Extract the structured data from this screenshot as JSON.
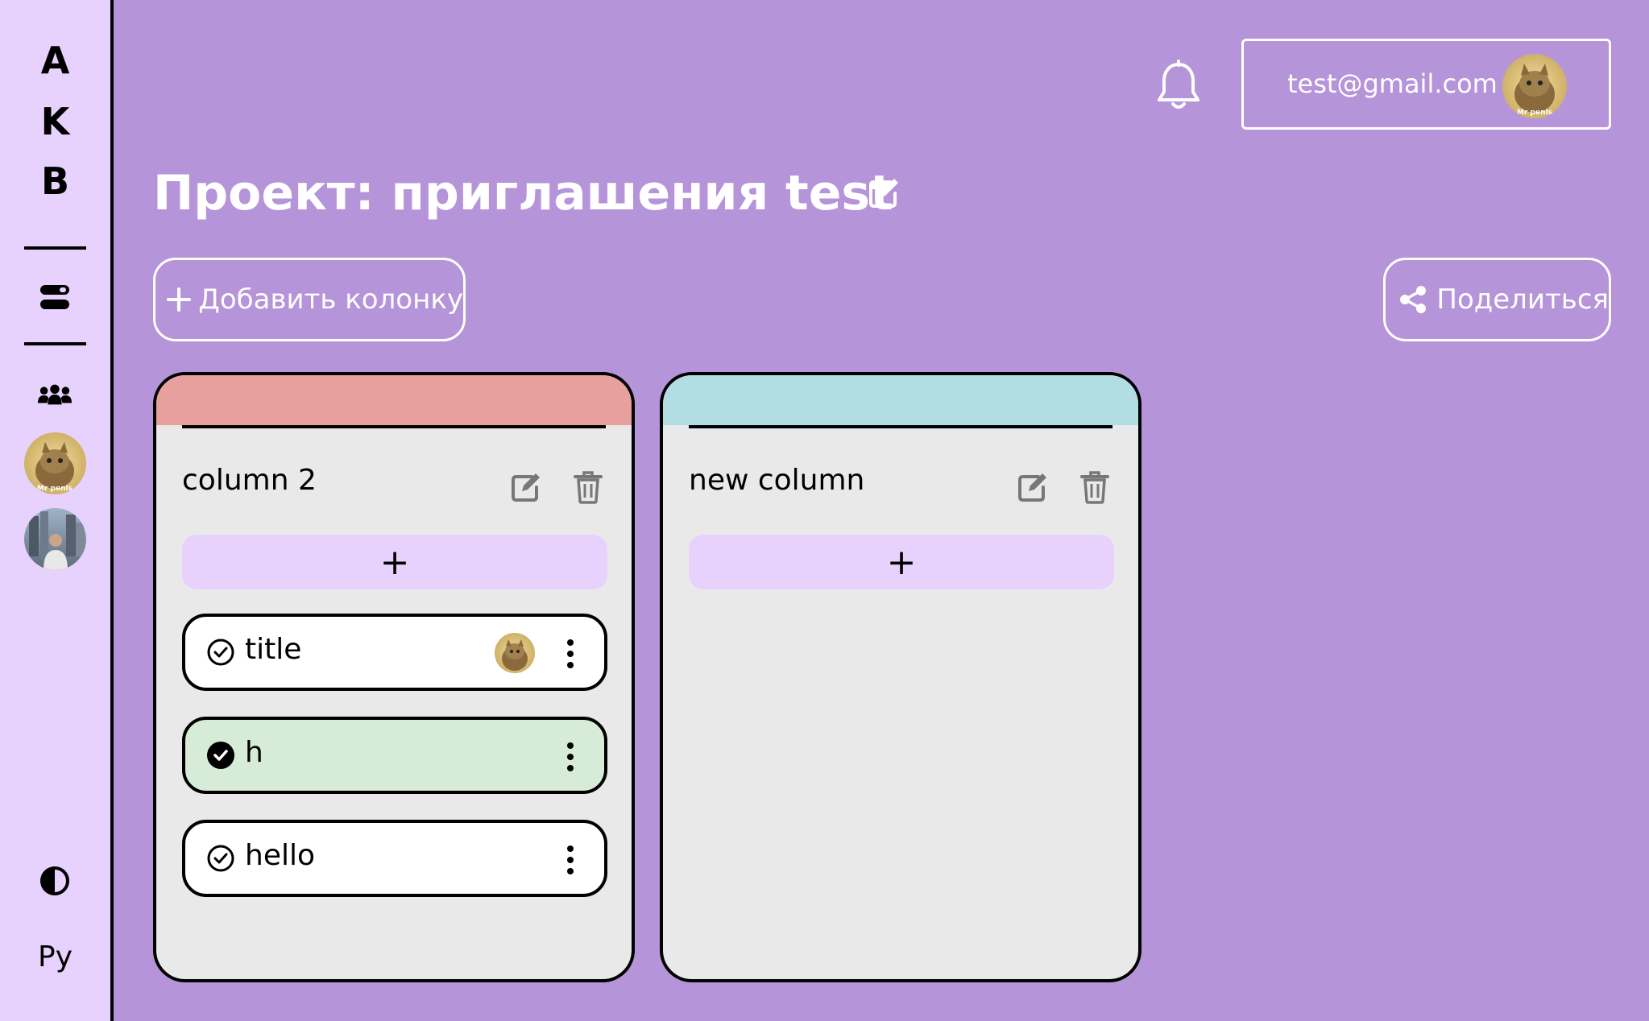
{
  "app": {
    "logo_letters": [
      "A",
      "K",
      "B"
    ],
    "language": "Py"
  },
  "header": {
    "user_email": "test@gmail.com",
    "avatar_caption": "Mr penis"
  },
  "project": {
    "title": "Проект: приглашения test"
  },
  "toolbar": {
    "add_column_label": "Добавить колонку",
    "share_label": "Поделиться"
  },
  "columns": [
    {
      "title": "column 2",
      "color": "#e8a09e",
      "add_label": "+",
      "cards": [
        {
          "title": "title",
          "done": false,
          "has_avatar": true
        },
        {
          "title": "h",
          "done": true,
          "has_avatar": false
        },
        {
          "title": "hello",
          "done": false,
          "has_avatar": false
        }
      ]
    },
    {
      "title": "new column",
      "color": "#b2dde2",
      "add_label": "+",
      "cards": []
    }
  ],
  "colors": {
    "background": "#b594d9",
    "sidebar": "#e7d2fd",
    "column_body": "#e9e9e9",
    "done_card": "#d7ecd7"
  }
}
